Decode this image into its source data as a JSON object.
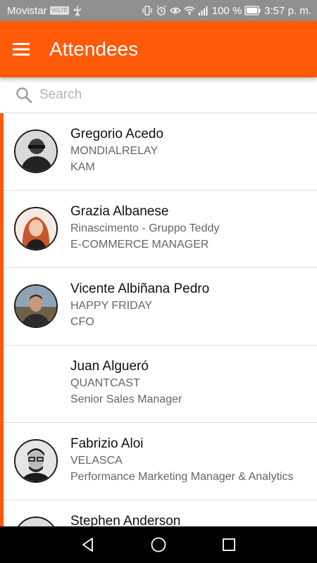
{
  "status_bar": {
    "carrier": "Movistar",
    "carrier_badge": "VoLTE",
    "battery": "100 %",
    "time": "3:57 p. m."
  },
  "app_bar": {
    "title": "Attendees",
    "menu_icon": "hamburger-menu-icon",
    "background": "#ff5a0a"
  },
  "search": {
    "placeholder": "Search",
    "value": "",
    "icon": "search-icon"
  },
  "attendees": [
    {
      "name": "Gregorio Acedo",
      "company": "MONDIALRELAY",
      "role": "KAM",
      "has_photo": true,
      "accent": true
    },
    {
      "name": "Grazia Albanese",
      "company": "Rinascimento - Gruppo Teddy",
      "role": "E-COMMERCE MANAGER",
      "has_photo": true,
      "accent": true
    },
    {
      "name": "Vicente Albiñana Pedro",
      "company": "HAPPY FRIDAY",
      "role": "CFO",
      "has_photo": true,
      "accent": true
    },
    {
      "name": "Juan Algueró",
      "company": "QUANTCAST",
      "role": "Senior Sales Manager",
      "has_photo": false,
      "accent": true
    },
    {
      "name": "Fabrizio Aloi",
      "company": "VELASCA",
      "role": "Performance Marketing Manager & Analytics",
      "has_photo": true,
      "accent": true
    },
    {
      "name": "Stephen Anderson",
      "company": "",
      "role": "",
      "has_photo": true,
      "accent": true
    }
  ],
  "nav_bar": {
    "back_icon": "back-triangle-icon",
    "home_icon": "home-circle-icon",
    "recents_icon": "recents-square-icon"
  }
}
